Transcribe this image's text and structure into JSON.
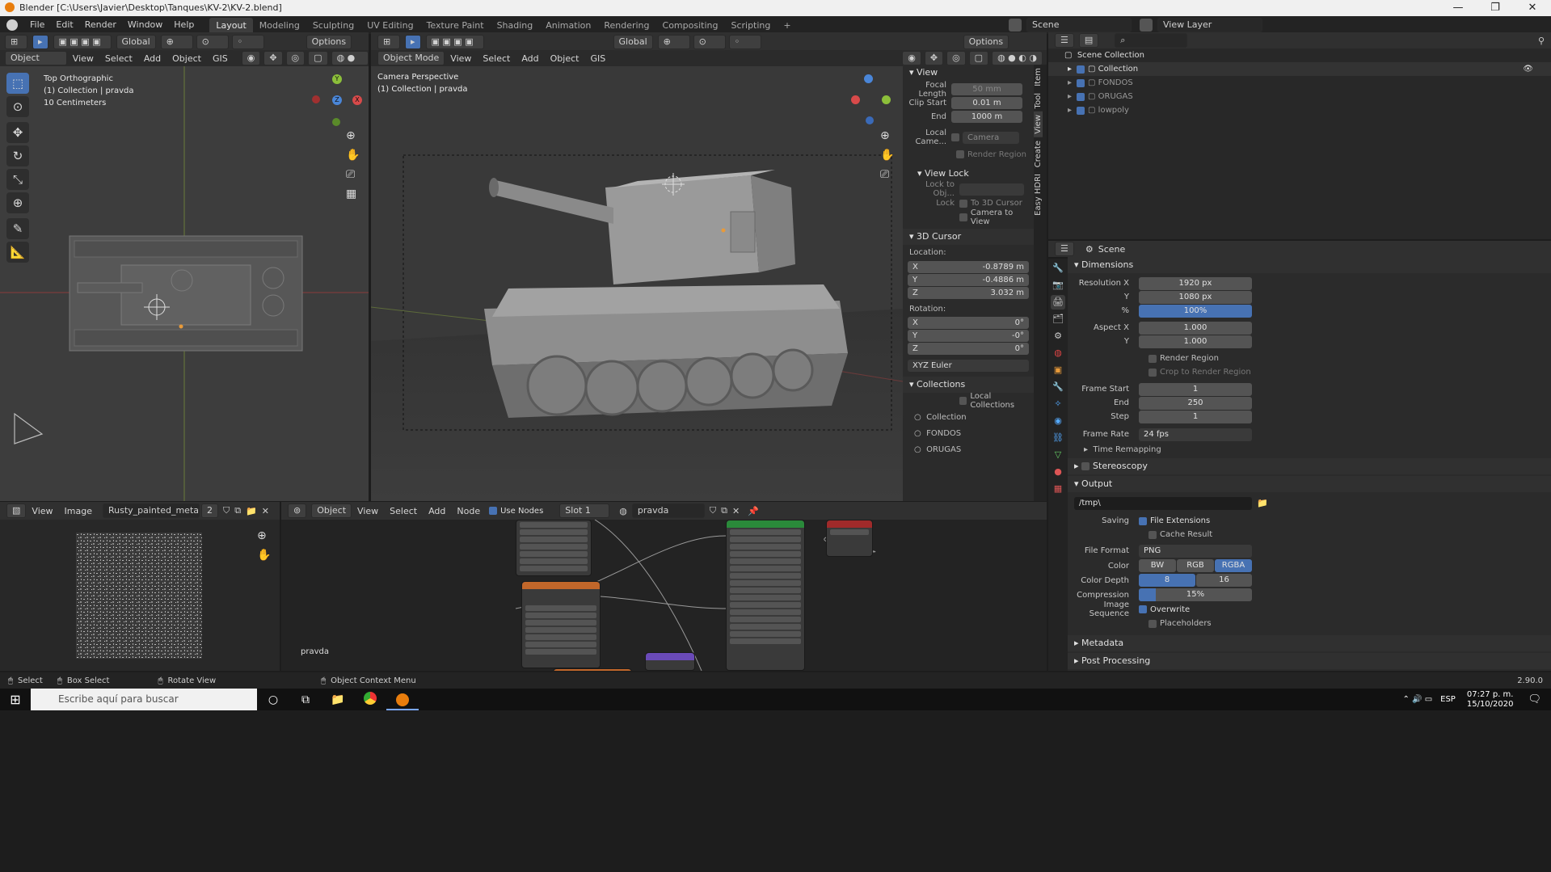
{
  "window": {
    "title": "Blender [C:\\Users\\Javier\\Desktop\\Tanques\\KV-2\\KV-2.blend]",
    "minimize": "—",
    "maximize": "❐",
    "close": "✕"
  },
  "menu": [
    "File",
    "Edit",
    "Render",
    "Window",
    "Help"
  ],
  "workspaces": [
    "Layout",
    "Modeling",
    "Sculpting",
    "UV Editing",
    "Texture Paint",
    "Shading",
    "Animation",
    "Rendering",
    "Compositing",
    "Scripting"
  ],
  "active_workspace": "Layout",
  "scene_selector": "Scene",
  "view_layer": "View Layer",
  "left_viewport": {
    "mode": "Object Mode",
    "menus": [
      "View",
      "Select",
      "Add",
      "Object",
      "GIS"
    ],
    "orientation": "Global",
    "options": "Options",
    "overlay_line1": "Top Orthographic",
    "overlay_line2": "(1) Collection | pravda",
    "overlay_line3": "10 Centimeters",
    "gizmo_y": "Y",
    "gizmo_z": "Z",
    "gizmo_x": "X"
  },
  "main_viewport": {
    "mode": "Object Mode",
    "menus": [
      "View",
      "Select",
      "Add",
      "Object",
      "GIS"
    ],
    "orientation": "Global",
    "options": "Options",
    "overlay_line1": "Camera Perspective",
    "overlay_line2": "(1) Collection | pravda"
  },
  "npanel": {
    "tabs": [
      "Item",
      "Tool",
      "View",
      "Create",
      "Easy HDRI"
    ],
    "view_section": "View",
    "focal_length_label": "Focal Length",
    "focal_length": "50 mm",
    "clip_start_label": "Clip Start",
    "clip_start": "0.01 m",
    "clip_end_label": "End",
    "clip_end": "1000 m",
    "local_camera_label": "Local Came...",
    "local_camera_value": "Camera",
    "render_region": "Render Region",
    "view_lock_section": "View Lock",
    "lock_to_obj": "Lock to Obj...",
    "lock_label": "Lock",
    "to_3d_cursor": "To 3D Cursor",
    "camera_to_view": "Camera to View",
    "cursor_section": "3D Cursor",
    "location_label": "Location:",
    "loc_x": "-0.8789 m",
    "loc_y": "-0.4886 m",
    "loc_z": "3.032 m",
    "rotation_label": "Rotation:",
    "rot_x": "0°",
    "rot_y": "-0°",
    "rot_z": "0°",
    "rotation_mode": "XYZ Euler",
    "collections_section": "Collections",
    "local_collections": "Local Collections",
    "collection_items": [
      "Collection",
      "FONDOS",
      "ORUGAS"
    ]
  },
  "outliner": {
    "root": "Scene Collection",
    "items": [
      "Collection",
      "FONDOS",
      "ORUGAS",
      "lowpoly"
    ]
  },
  "properties": {
    "header": "Scene",
    "dimensions": "Dimensions",
    "res_x_label": "Resolution X",
    "res_x": "1920 px",
    "res_y_label": "Y",
    "res_y": "1080 px",
    "res_pct_label": "%",
    "res_pct": "100%",
    "aspect_x_label": "Aspect X",
    "aspect_x": "1.000",
    "aspect_y_label": "Y",
    "aspect_y": "1.000",
    "render_region": "Render Region",
    "crop_region": "Crop to Render Region",
    "frame_start_label": "Frame Start",
    "frame_start": "1",
    "frame_end_label": "End",
    "frame_end": "250",
    "frame_step_label": "Step",
    "frame_step": "1",
    "frame_rate_label": "Frame Rate",
    "frame_rate": "24 fps",
    "time_remapping": "Time Remapping",
    "stereoscopy": "Stereoscopy",
    "output": "Output",
    "output_path": "/tmp\\",
    "saving_label": "Saving",
    "file_extensions": "File Extensions",
    "cache_result": "Cache Result",
    "file_format_label": "File Format",
    "file_format": "PNG",
    "color_label": "Color",
    "color_bw": "BW",
    "color_rgb": "RGB",
    "color_rgba": "RGBA",
    "depth_label": "Color Depth",
    "depth_8": "8",
    "depth_16": "16",
    "compression_label": "Compression",
    "compression": "15%",
    "compression_level": 0.15,
    "image_seq_label": "Image Sequence",
    "overwrite": "Overwrite",
    "placeholders": "Placeholders",
    "metadata": "Metadata",
    "post_processing": "Post Processing"
  },
  "image_editor": {
    "menus": [
      "View",
      "Image"
    ],
    "image_name": "Rusty_painted_meta...",
    "users": "2"
  },
  "node_editor": {
    "object": "Object",
    "menus": [
      "View",
      "Select",
      "Add",
      "Node"
    ],
    "use_nodes": "Use Nodes",
    "slot": "Slot 1",
    "material": "pravda",
    "label": "pravda"
  },
  "status": {
    "select": "Select",
    "box_select": "Box Select",
    "rotate_view": "Rotate View",
    "context_menu": "Object Context Menu",
    "version": "2.90.0"
  },
  "taskbar": {
    "search_placeholder": "Escribe aquí para buscar",
    "lang": "ESP",
    "time": "07:27 p. m.",
    "date": "15/10/2020"
  }
}
